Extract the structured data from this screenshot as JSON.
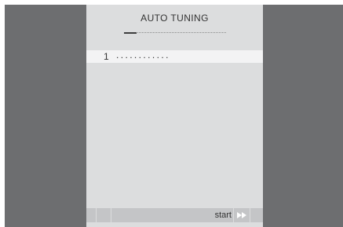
{
  "screen": {
    "title": "AUTO TUNING",
    "progress_fraction": 0.12
  },
  "channel_row": {
    "number": "1",
    "name_placeholder": "............"
  },
  "footer": {
    "start_label": "start",
    "icon": "fast-forward-icon"
  },
  "colors": {
    "background": "#6d6e70",
    "panel": "#dcddde",
    "highlight_row": "#f3f3f4",
    "bottom_bar": "#c4c5c7",
    "text": "#333333"
  }
}
